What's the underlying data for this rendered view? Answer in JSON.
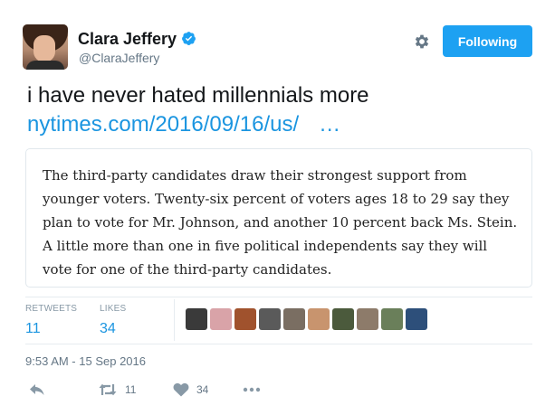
{
  "author": {
    "name": "Clara Jeffery",
    "handle": "@ClaraJeffery"
  },
  "follow_button": {
    "label": "Following"
  },
  "tweet": {
    "text": "i have never hated millennials more",
    "link_text": "nytimes.com/2016/09/16/us/",
    "link_ellipsis": "…"
  },
  "quote": {
    "text": "The third-party candidates draw their strongest support from younger voters. Twenty-six percent of voters ages 18 to 29 say they plan to vote for Mr. Johnson, and another 10 percent back Ms. Stein. A little more than one in five political independents say they will vote for one of the third-party candidates."
  },
  "stats": {
    "retweets_label": "RETWEETS",
    "retweets_value": "11",
    "likes_label": "LIKES",
    "likes_value": "34"
  },
  "likers": [
    {
      "name": "liker-1",
      "color": "#3a3a3a"
    },
    {
      "name": "liker-2",
      "color": "#d9a3a8"
    },
    {
      "name": "liker-3",
      "color": "#a0522d"
    },
    {
      "name": "liker-4",
      "color": "#5a5a5a"
    },
    {
      "name": "liker-5",
      "color": "#7a6e62"
    },
    {
      "name": "liker-6",
      "color": "#c8946e"
    },
    {
      "name": "liker-7",
      "color": "#4b5a3c"
    },
    {
      "name": "liker-8",
      "color": "#8d7b6a"
    },
    {
      "name": "liker-9",
      "color": "#6a7f5a"
    },
    {
      "name": "liker-10",
      "color": "#2d4f7a"
    }
  ],
  "timestamp": "9:53 AM - 15 Sep 2016",
  "actions": {
    "retweet_count": "11",
    "like_count": "34"
  },
  "colors": {
    "accent": "#1da1f2",
    "link": "#1b95e0",
    "muted": "#657786"
  }
}
